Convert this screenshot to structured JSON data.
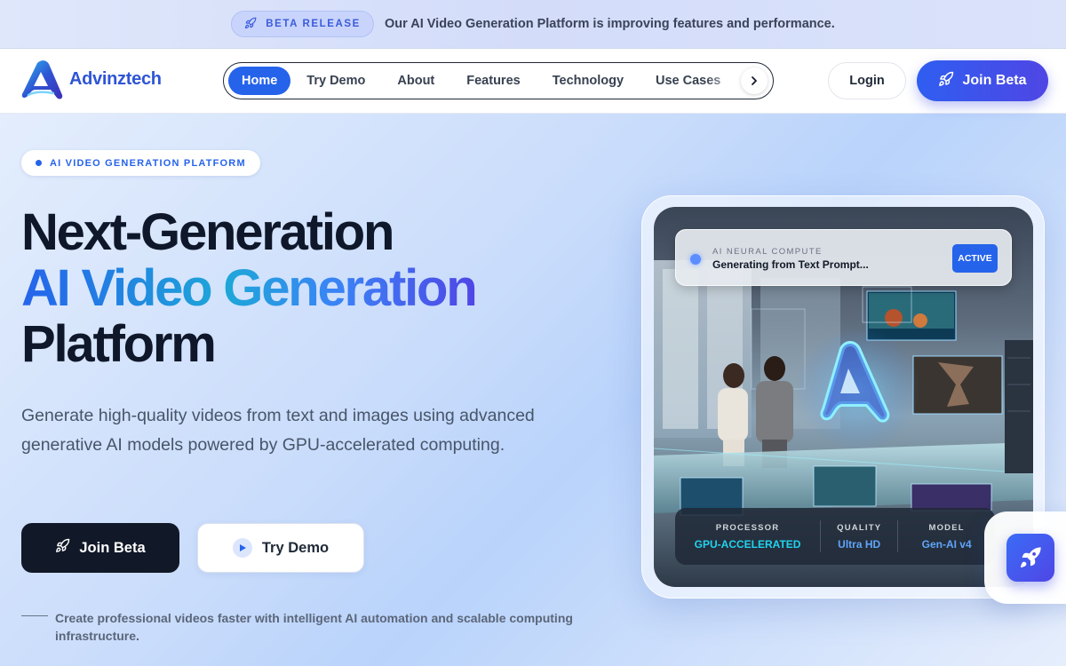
{
  "announcement": {
    "badge": "BETA RELEASE",
    "badge_icon": "rocket-icon",
    "text": "Our AI Video Generation Platform is improving features and performance."
  },
  "brand": {
    "name": "Advinztech",
    "logo_icon": "logo-a-mark",
    "color": "#2f55d4"
  },
  "nav": {
    "items": [
      {
        "label": "Home",
        "active": true
      },
      {
        "label": "Try Demo",
        "active": false
      },
      {
        "label": "About",
        "active": false
      },
      {
        "label": "Features",
        "active": false
      },
      {
        "label": "Technology",
        "active": false
      },
      {
        "label": "Use Cases",
        "active": false
      }
    ],
    "next_icon": "chevron-right-icon",
    "login_label": "Login",
    "join_label": "Join Beta",
    "accent": "#2563eb"
  },
  "hero": {
    "badge": "AI VIDEO GENERATION PLATFORM",
    "title_line1": "Next-Generation",
    "title_line2": "AI Video Generation",
    "title_line3": "Platform",
    "subtitle": "Generate high-quality videos from text and images using advanced generative AI models powered by GPU-accelerated computing.",
    "cta_primary": "Join Beta",
    "cta_secondary": "Try Demo",
    "footnote": "Create professional videos faster with intelligent AI automation and scalable computing infrastructure."
  },
  "visual": {
    "status_label": "AI NEURAL COMPUTE",
    "status_text": "Generating from Text Prompt...",
    "status_badge": "ACTIVE",
    "stats": [
      {
        "label": "PROCESSOR",
        "value": "GPU-ACCELERATED",
        "color": "#22d3ee"
      },
      {
        "label": "QUALITY",
        "value": "Ultra HD",
        "color": "#60a5fa"
      },
      {
        "label": "MODEL",
        "value": "Gen-AI v4",
        "color": "#60a5fa"
      }
    ],
    "fab_icon": "rocket-icon"
  }
}
